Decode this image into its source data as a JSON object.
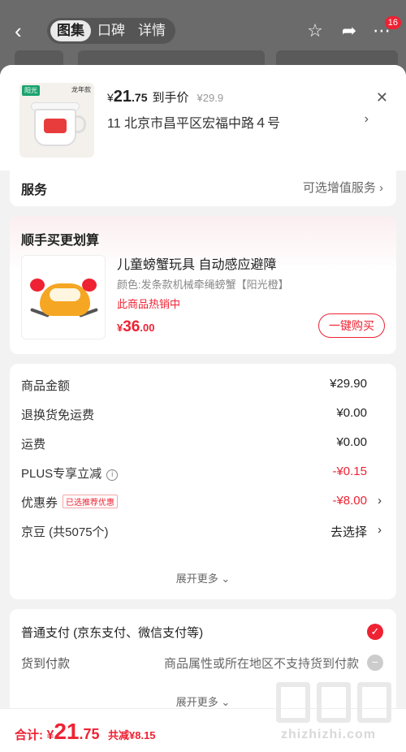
{
  "topbar": {
    "tabs": [
      "图集",
      "口碑",
      "详情"
    ],
    "cart_badge": "16"
  },
  "product": {
    "brand": "阳光",
    "tag": "龙年款",
    "price_symbol": "¥",
    "price_int": "21",
    "price_dec": ".75",
    "price_label": "到手价",
    "orig_price": "¥29.9",
    "address": "11  北京市昌平区宏福中路４号"
  },
  "service": {
    "label": "服务",
    "value": "可选增值服务"
  },
  "bundle": {
    "title": "顺手买更划算",
    "name": "儿童螃蟹玩具 自动感应避障",
    "attr": "颜色:发条款机械牵绳螃蟹【阳光橙】",
    "hot": "此商品热销中",
    "price_symbol": "¥",
    "price_int": "36",
    "price_dec": ".00",
    "buy_label": "一键购买"
  },
  "costs": {
    "rows": [
      {
        "label": "商品金额",
        "value": "¥29.90"
      },
      {
        "label": "退换货免运费",
        "value": "¥0.00"
      },
      {
        "label": "运费",
        "value": "¥0.00"
      },
      {
        "label": "PLUS专享立减",
        "value": "-¥0.15"
      },
      {
        "label": "优惠券",
        "value": "-¥8.00",
        "tag": "已选推荐优惠"
      },
      {
        "label": "京豆 (共5075个)",
        "value": "去选择"
      }
    ],
    "expand": "展开更多 ⌄"
  },
  "payment": {
    "option1": "普通支付 (京东支付、微信支付等)",
    "option2_label": "货到付款",
    "option2_note": "商品属性或所在地区不支持货到付款",
    "expand": "展开更多 ⌄"
  },
  "footer": {
    "label": "合计:",
    "symbol": "¥",
    "int": "21",
    "dec": ".75",
    "saved": "共减¥8.15"
  },
  "watermark": "zhizhizhi.com",
  "colors": {
    "accent": "#e62233"
  }
}
